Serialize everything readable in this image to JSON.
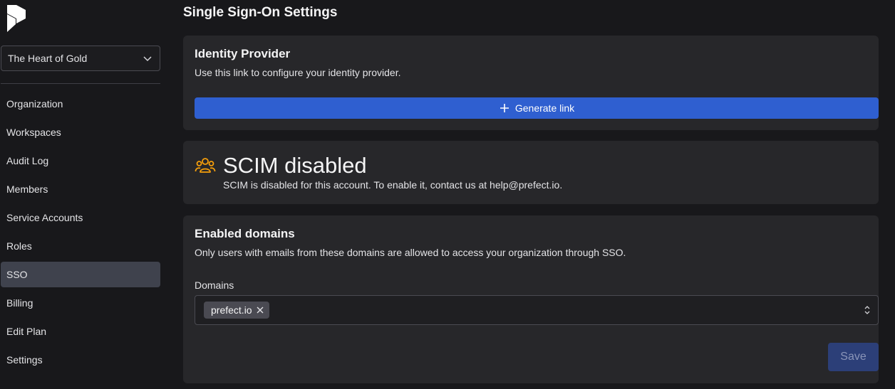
{
  "sidebar": {
    "team_name": "The Heart of Gold",
    "items": [
      {
        "label": "Organization"
      },
      {
        "label": "Workspaces"
      },
      {
        "label": "Audit Log"
      },
      {
        "label": "Members"
      },
      {
        "label": "Service Accounts"
      },
      {
        "label": "Roles"
      },
      {
        "label": "SSO",
        "active": true
      },
      {
        "label": "Billing"
      },
      {
        "label": "Edit Plan"
      },
      {
        "label": "Settings"
      }
    ]
  },
  "main": {
    "title": "Single Sign-On Settings",
    "identity_provider": {
      "title": "Identity Provider",
      "description": "Use this link to configure your identity provider.",
      "button_label": "Generate link"
    },
    "scim": {
      "title": "SCIM disabled",
      "description": "SCIM is disabled for this account. To enable it, contact us at help@prefect.io."
    },
    "domains": {
      "title": "Enabled domains",
      "description": "Only users with emails from these domains are allowed to access your organization through SSO.",
      "field_label": "Domains",
      "chips": [
        "prefect.io"
      ],
      "save_label": "Save"
    }
  },
  "colors": {
    "accent": "#2f5fd0",
    "scim_icon": "#f59e0b",
    "background": "#18181b",
    "card": "#27272a"
  }
}
